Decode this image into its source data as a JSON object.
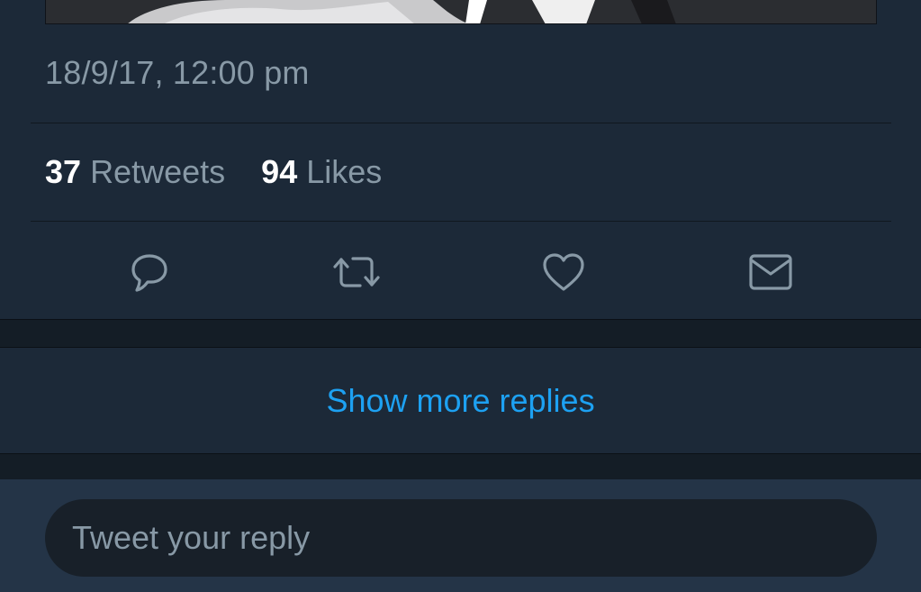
{
  "tweet": {
    "timestamp": "18/9/17, 12:00 pm",
    "retweets_count": "37",
    "retweets_label": "Retweets",
    "likes_count": "94",
    "likes_label": "Likes"
  },
  "actions": [
    {
      "name": "reply",
      "icon": "reply-bubble-icon"
    },
    {
      "name": "retweet",
      "icon": "retweet-icon"
    },
    {
      "name": "like",
      "icon": "heart-icon"
    },
    {
      "name": "share",
      "icon": "envelope-icon"
    }
  ],
  "replies": {
    "show_more_label": "Show more replies"
  },
  "composer": {
    "placeholder": "Tweet your reply"
  },
  "colors": {
    "background": "#1c2938",
    "muted_text": "#8899a6",
    "accent": "#1da1f2",
    "icon": "#8899a6"
  }
}
